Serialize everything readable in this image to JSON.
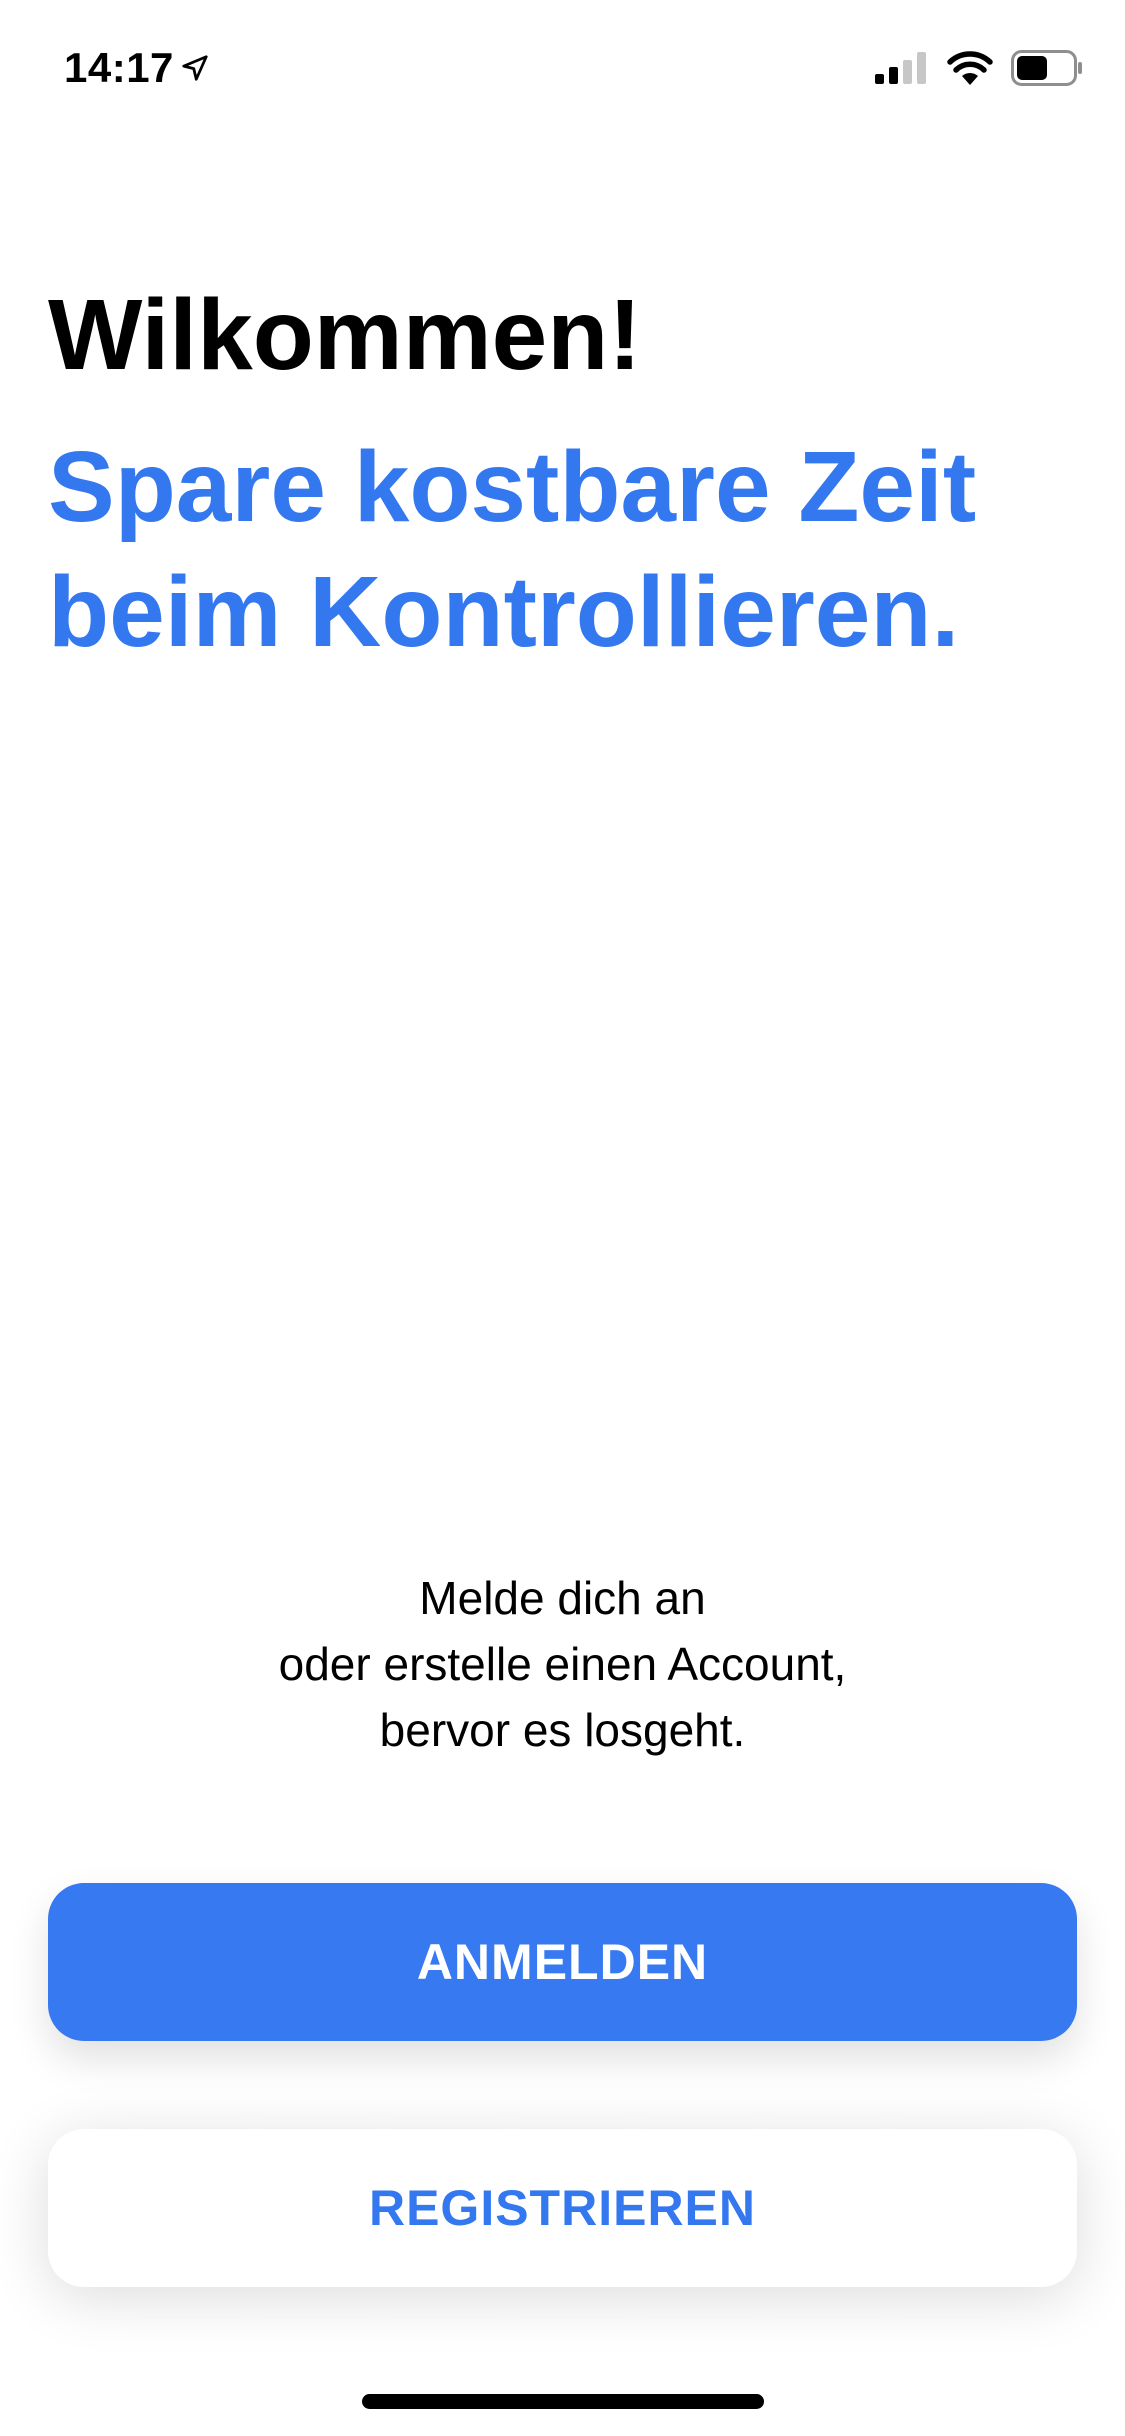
{
  "status_bar": {
    "time": "14:17",
    "location_icon": "location-arrow-icon",
    "signal_icon": "cellular-signal-icon",
    "wifi_icon": "wifi-icon",
    "battery_icon": "battery-icon",
    "signal_bars_active": 2,
    "signal_bars_total": 4,
    "battery_level": 0.5
  },
  "welcome": {
    "title": "Wilkommen!",
    "subtitle": "Spare kostbare Zeit beim Kontrollieren."
  },
  "info": {
    "lines": [
      "Melde dich an",
      "oder erstelle einen Account,",
      "bervor es losgeht."
    ]
  },
  "actions": {
    "login_label": "ANMELDEN",
    "register_label": "REGISTRIEREN"
  },
  "colors": {
    "accent": "#3478f0",
    "primary_button": "#3679f0",
    "text": "#000000",
    "background": "#ffffff"
  }
}
